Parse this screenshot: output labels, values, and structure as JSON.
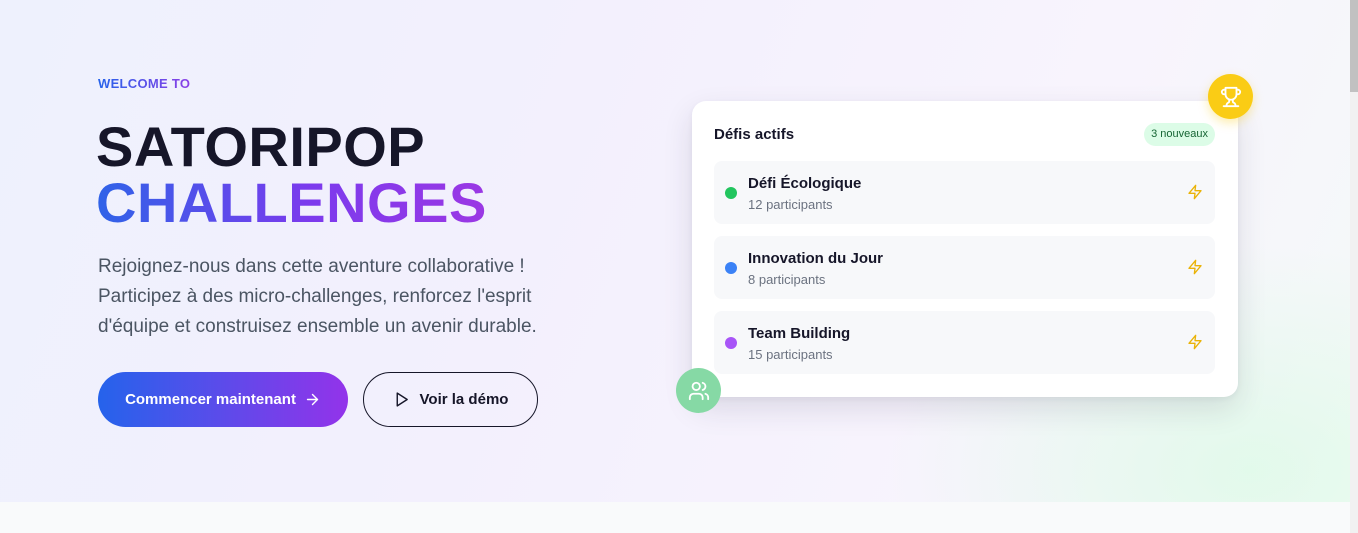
{
  "hero": {
    "eyebrow": "WELCOME TO",
    "title_line1": "SATORIPOP",
    "title_line2": "CHALLENGES",
    "description": "Rejoignez-nous dans cette aventure collaborative ! Participez à des micro-challenges, renforcez l'esprit d'équipe et construisez ensemble un avenir durable.",
    "primary_button": "Commencer maintenant",
    "secondary_button": "Voir la démo"
  },
  "card": {
    "title": "Défis actifs",
    "badge": "3 nouveaux",
    "items": [
      {
        "name": "Défi Écologique",
        "participants": "12 participants",
        "dot_color": "#22c55e",
        "icon": "zap-icon"
      },
      {
        "name": "Innovation du Jour",
        "participants": "8 participants",
        "dot_color": "#3b82f6",
        "icon": "zap-icon"
      },
      {
        "name": "Team Building",
        "participants": "15 participants",
        "dot_color": "#a855f7",
        "icon": "zap-icon"
      }
    ]
  },
  "decorations": {
    "top_icon": "trophy-icon",
    "bottom_icon": "users-icon"
  },
  "colors": {
    "gradient_start": "#2563eb",
    "gradient_end": "#9333ea",
    "bolt": "#eab308",
    "trophy_bg": "#facc15",
    "users_bg": "#86d9a5",
    "badge_bg": "#dcfce7"
  }
}
